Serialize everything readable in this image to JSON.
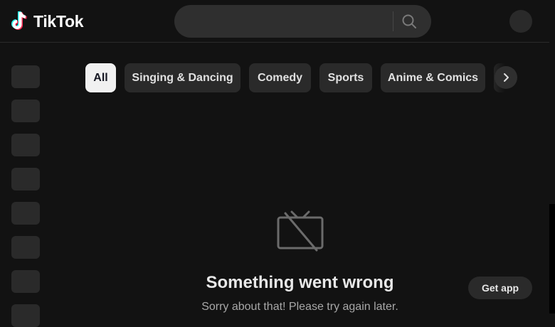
{
  "header": {
    "logo_text": "TikTok",
    "search_placeholder": ""
  },
  "sidebar": {
    "items": [
      {
        "icon": "placeholder"
      },
      {
        "icon": "placeholder"
      },
      {
        "icon": "placeholder"
      },
      {
        "icon": "placeholder"
      },
      {
        "icon": "placeholder"
      },
      {
        "icon": "placeholder"
      },
      {
        "icon": "placeholder"
      },
      {
        "icon": "placeholder"
      }
    ]
  },
  "categories": {
    "tabs": [
      {
        "label": "All",
        "active": true
      },
      {
        "label": "Singing & Dancing",
        "active": false
      },
      {
        "label": "Comedy",
        "active": false
      },
      {
        "label": "Sports",
        "active": false
      },
      {
        "label": "Anime & Comics",
        "active": false
      }
    ]
  },
  "error": {
    "title": "Something went wrong",
    "message": "Sorry about that! Please try again later."
  },
  "get_app_label": "Get app",
  "colors": {
    "background": "#121212",
    "surface": "#2a2a2a",
    "active_tab": "#f1f1f1",
    "logo_cyan": "#25F4EE",
    "logo_red": "#FE2C55"
  }
}
